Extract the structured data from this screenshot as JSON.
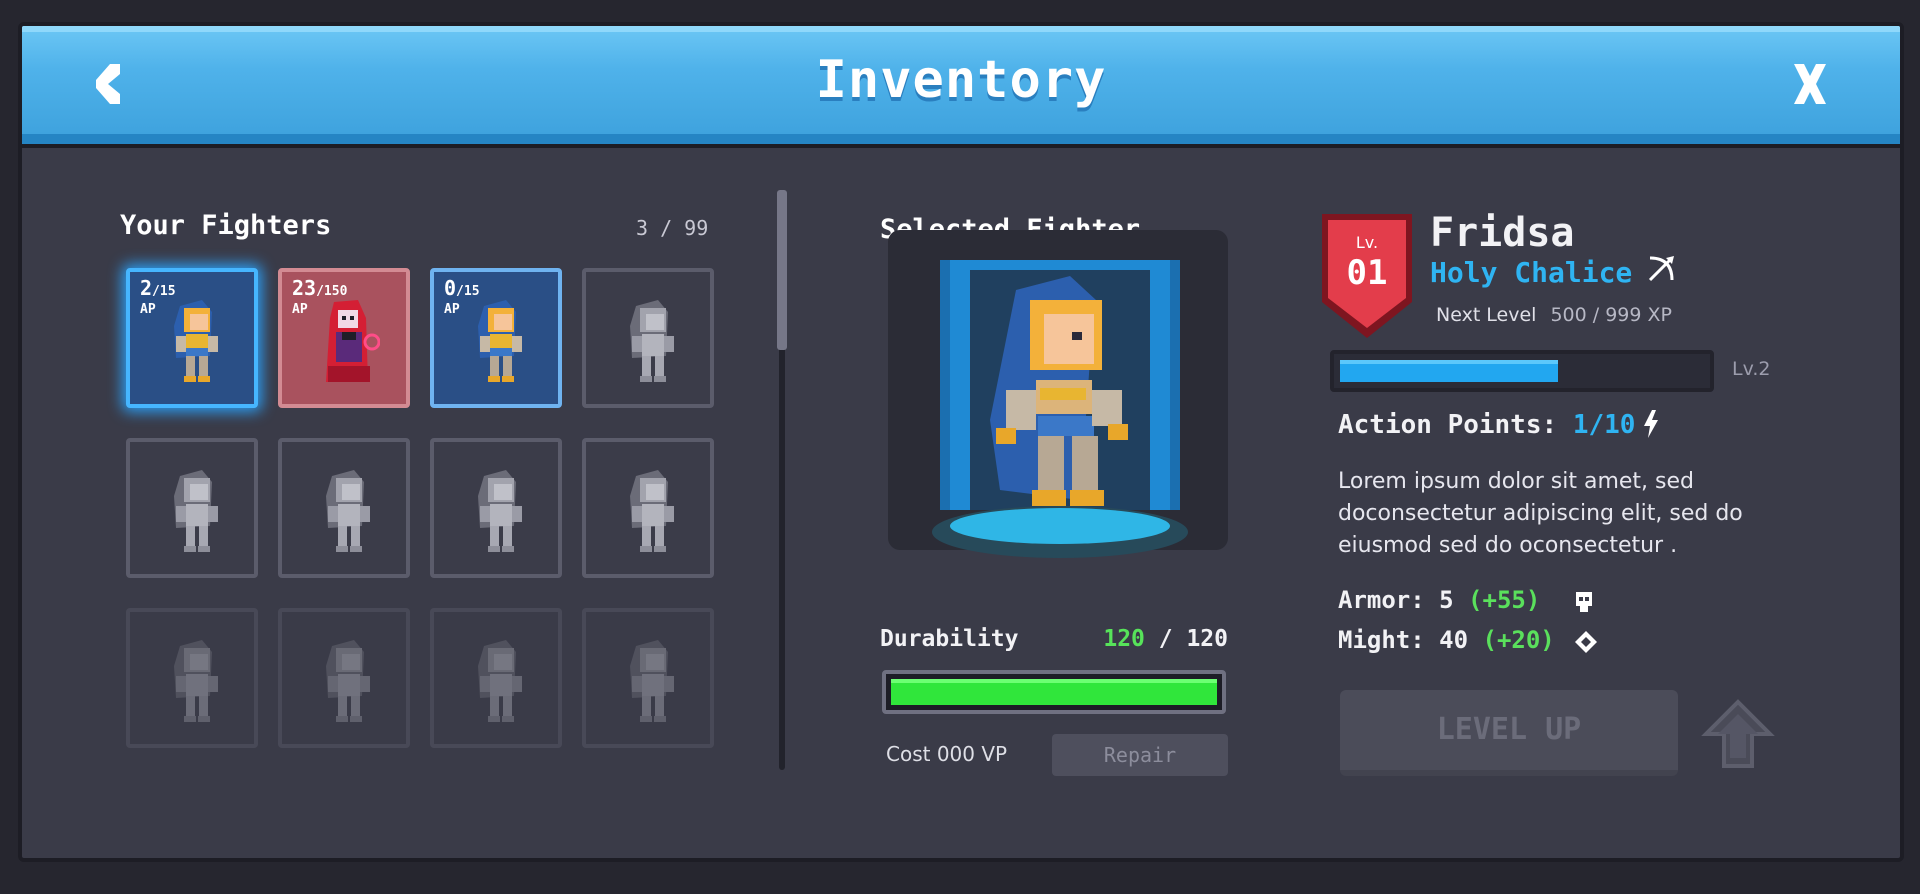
{
  "window": {
    "title": "Inventory",
    "colors": {
      "titlebar": "#4fb2ea",
      "panel": "#3a3b48",
      "accent": "#2fb4f2",
      "success": "#57e35a"
    }
  },
  "fighters": {
    "title": "Your Fighters",
    "count": "3 / 99",
    "slots": [
      {
        "state": "selected",
        "sprite": "fridsa",
        "ap_current": "2",
        "ap_max": "/15",
        "ap_label": "AP"
      },
      {
        "state": "filled",
        "sprite": "red-mage",
        "ap_current": "23",
        "ap_max": "/150",
        "ap_label": "AP"
      },
      {
        "state": "filled",
        "sprite": "fridsa",
        "ap_current": "0",
        "ap_max": "/15",
        "ap_label": "AP"
      },
      {
        "state": "empty",
        "sprite": "silhouette"
      },
      {
        "state": "empty",
        "sprite": "silhouette"
      },
      {
        "state": "empty",
        "sprite": "silhouette"
      },
      {
        "state": "empty",
        "sprite": "silhouette"
      },
      {
        "state": "empty",
        "sprite": "silhouette"
      },
      {
        "state": "locked",
        "sprite": "silhouette"
      },
      {
        "state": "locked",
        "sprite": "silhouette"
      },
      {
        "state": "locked",
        "sprite": "silhouette"
      },
      {
        "state": "locked",
        "sprite": "silhouette"
      }
    ]
  },
  "selected": {
    "title": "Selected Fighter",
    "durability_label": "Durability",
    "durability_current": "120",
    "durability_separator": " / ",
    "durability_max": "120",
    "durability_fraction": 1.0,
    "cost": "Cost 000 VP",
    "repair_label": "Repair"
  },
  "details": {
    "level_label": "Lv.",
    "level": "01",
    "name": "Fridsa",
    "subtitle": "Holy Chalice",
    "next_level_label": "Next Level",
    "xp": "500 / 999 XP",
    "xp_fraction": 0.6,
    "next_level_short": "Lv.2",
    "ap_label": "Action Points:",
    "ap_value": "1/10",
    "description": "Lorem ipsum dolor sit amet, sed doconsectetur adipiscing elit, sed do eiusmod sed do oconsectetur .",
    "armor_label": "Armor: 5",
    "armor_bonus": "(+55)",
    "might_label": "Might: 40",
    "might_bonus": "(+20)",
    "level_up_label": "LEVEL UP",
    "icons": [
      "bow-icon",
      "bolt-icon",
      "skull-icon",
      "diamond-icon",
      "up-arrow-icon"
    ]
  }
}
